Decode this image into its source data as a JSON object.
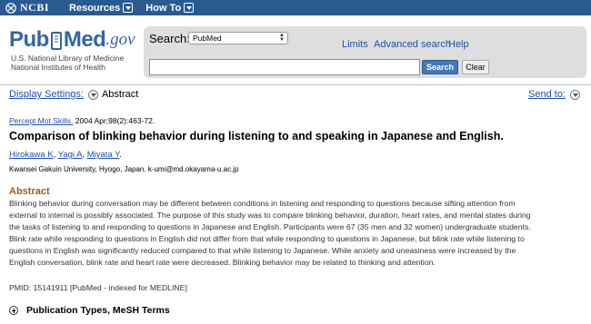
{
  "ncbi_bar": {
    "logo_text": "NCBI",
    "menu": [
      {
        "label": "Resources"
      },
      {
        "label": "How To"
      }
    ]
  },
  "header": {
    "logo": {
      "pub": "Pub",
      "med": "Med",
      "gov": ".gov"
    },
    "org_line1": "U.S. National Library of Medicine",
    "org_line2": "National Institutes of Health",
    "search_label": "Search:",
    "db_selected": "PubMed",
    "search_value": "",
    "search_button": "Search",
    "clear_button": "Clear",
    "links": [
      "Limits",
      "Advanced search",
      "Help"
    ]
  },
  "display": {
    "settings_label": "Display Settings:",
    "format": "Abstract",
    "send_to": "Send to:"
  },
  "article": {
    "journal": "Percept Mot Skills.",
    "citation_rest": "2004 Apr;98(2):463-72.",
    "title": "Comparison of blinking behavior during listening to and speaking in Japanese and English.",
    "authors": [
      "Hirokawa K",
      "Yagi A",
      "Miyata Y"
    ],
    "author_seps": [
      ", ",
      ", ",
      "."
    ],
    "affiliation": "Kwansei Gakuin University, Hyogo, Japan. k-umi@md.okayama-u.ac.jp",
    "abstract_heading": "Abstract",
    "abstract_lines": [
      "Blinking behavior during conversation may be different between conditions in listening and responding to questions because sifting attention from",
      "external to internal is possibly associated. The purpose of this study was to compare blinking behavior, duration, heart rates, and mental states during",
      "the tasks of listening to and responding to questions in Japanese and English. Participants were 67 (35 men and 32 women) undergraduate students.",
      "Blink rate while responding to questions in English did not differ from that while responding to questions in Japanese, but blink rate while listening to",
      "questions in English was significantly reduced compared to that while listening to Japanese. While anxiety and uneasiness were increased by the",
      "English conversation, blink rate and heart rate were decreased. Blinking behavior may be related to thinking and attention."
    ],
    "pmid": "PMID: 15141911 [PubMed - indexed for MEDLINE]",
    "publication_types": "Publication Types, MeSH Terms"
  },
  "colors": {
    "ncbi_bar": "#2a5a8f",
    "link": "#1e4fae",
    "abstract_heading": "#a8561d",
    "search_button": "#4478b8"
  }
}
